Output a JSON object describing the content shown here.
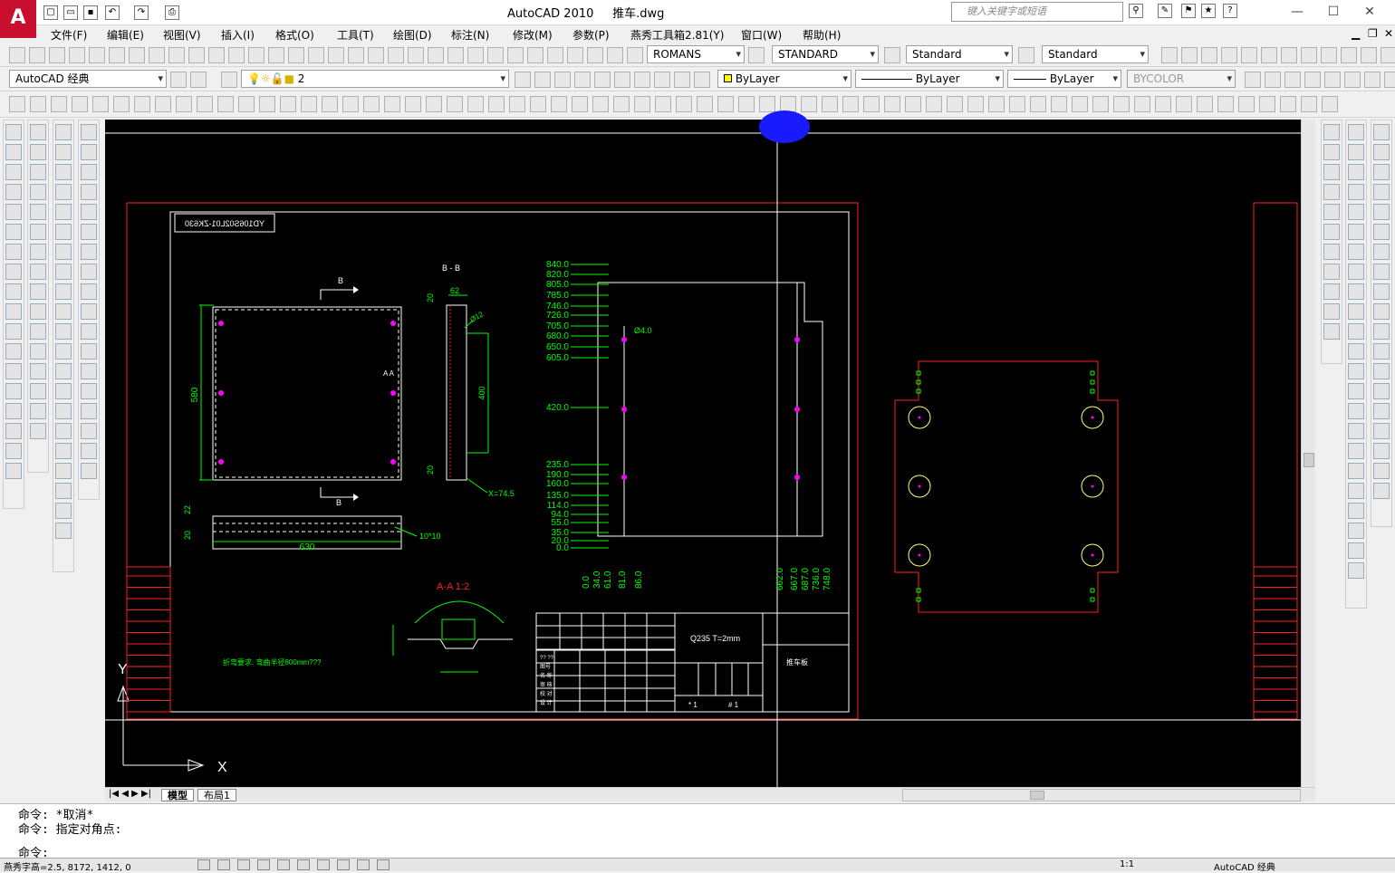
{
  "window": {
    "app_title": "AutoCAD 2010",
    "file_name": "推车.dwg",
    "search_placeholder": "键入关键字或短语"
  },
  "menu": [
    "文件(F)",
    "编辑(E)",
    "视图(V)",
    "插入(I)",
    "格式(O)",
    "工具(T)",
    "绘图(D)",
    "标注(N)",
    "修改(M)",
    "参数(P)",
    "燕秀工具箱2.81(Y)",
    "窗口(W)",
    "帮助(H)"
  ],
  "styles": {
    "text_style": "ROMANS",
    "dim_style": "STANDARD",
    "table_style": "Standard",
    "multileader_style": "Standard"
  },
  "workspace": "AutoCAD 经典",
  "layer": "2",
  "properties": {
    "color": "ByLayer",
    "linetype": "ByLayer",
    "lineweight": "ByLayer",
    "plotstyle": "BYCOLOR"
  },
  "layout_tabs": [
    "模型",
    "布局1"
  ],
  "command": {
    "history": [
      "命令: *取消*",
      "命令: 指定对角点:"
    ],
    "prompt": "命令:"
  },
  "status": {
    "coords": "燕秀字高=2.5, 8172, 1412, 0",
    "workspace_label": "AutoCAD 经典",
    "scale": "1:1"
  },
  "drawing": {
    "label_box": "YD106S02L01-ZK630",
    "section_bb": "B - B",
    "section_b": "B",
    "section_aa_marker": "A  A",
    "section_aa_title": "A-A  1:2",
    "dim_580": "580",
    "dim_630": "630",
    "dim_400": "400",
    "dim_20": "20",
    "dim_22": "22",
    "dim_62": "62",
    "dim_r12": "Ø12",
    "dim_x745": "X=74.5",
    "dim_10x10": "10*10",
    "dim_d4": "Ø4.0",
    "note": "折弯要求: 弯曲半径800mm???",
    "material": "Q235  T=2mm",
    "part_name": "推车板",
    "left_ordinates": [
      "840.0",
      "820.0",
      "805.0",
      "785.0",
      "746.0",
      "726.0",
      "705.0",
      "680.0",
      "650.0",
      "605.0",
      "420.0",
      "235.0",
      "190.0",
      "160.0",
      "135.0",
      "114.0",
      "94.0",
      "55.0",
      "35.0",
      "20.0",
      "0.0"
    ],
    "bottom_ordinates_left": [
      "0.0",
      "34.0",
      "61.0",
      "81.0",
      "86.0"
    ],
    "bottom_ordinates_right": [
      "662.0",
      "667.0",
      "687.0",
      "736.0",
      "748.0"
    ],
    "title_rows": [
      "?? ??",
      "图号",
      "名 称",
      "审 核",
      "校 对",
      "设 计"
    ],
    "scale_row": [
      "* 1",
      "# 1"
    ],
    "ucs_x": "X",
    "ucs_y": "Y"
  }
}
